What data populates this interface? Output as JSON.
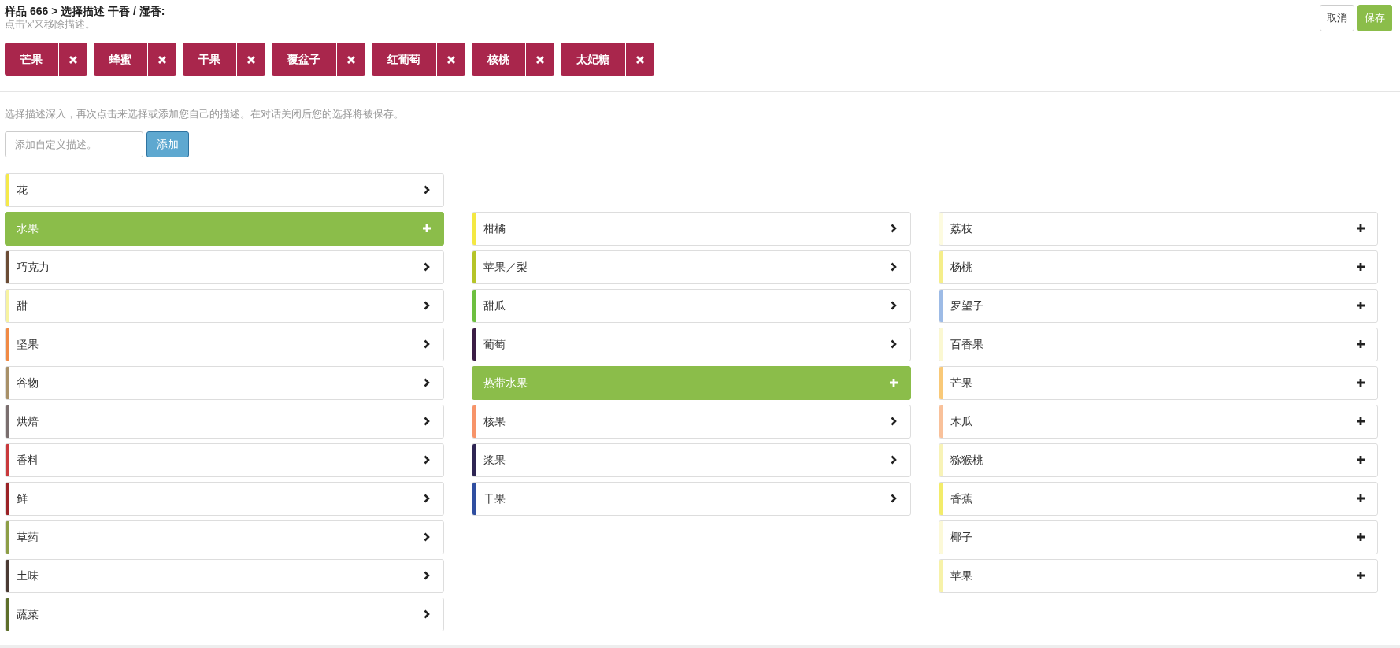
{
  "header": {
    "title": "样品 666 > 选择描述 干香 / 湿香:",
    "hint": "点击'x'来移除描述。"
  },
  "actions": [
    {
      "label": "取消",
      "kind": "secondary"
    },
    {
      "label": "保存",
      "kind": "primary"
    }
  ],
  "selected_tags": [
    {
      "label": "芒果"
    },
    {
      "label": "蜂蜜"
    },
    {
      "label": "干果"
    },
    {
      "label": "覆盆子"
    },
    {
      "label": "红葡萄"
    },
    {
      "label": "核桃"
    },
    {
      "label": "太妃糖"
    }
  ],
  "instructions": "选择描述深入，再次点击来选择或添加您自己的描述。在对话关闭后您的选择将被保存。",
  "custom_input": {
    "placeholder": "添加自定义描述。",
    "button": "添加"
  },
  "columns": [
    {
      "items": [
        {
          "label": "花",
          "color": "#f5e94a",
          "selected": false,
          "expandable": true
        },
        {
          "label": "水果",
          "selected": true
        },
        {
          "label": "巧克力",
          "color": "#6b4c35",
          "selected": false,
          "expandable": true
        },
        {
          "label": "甜",
          "color": "#f7f3a0",
          "selected": false,
          "expandable": true
        },
        {
          "label": "坚果",
          "color": "#f08a45",
          "selected": false,
          "expandable": true
        },
        {
          "label": "谷物",
          "color": "#a89068",
          "selected": false,
          "expandable": true
        },
        {
          "label": "烘焙",
          "color": "#7a6e6e",
          "selected": false,
          "expandable": true
        },
        {
          "label": "香料",
          "color": "#c9393c",
          "selected": false,
          "expandable": true
        },
        {
          "label": "鲜",
          "color": "#9b2226",
          "selected": false,
          "expandable": true
        },
        {
          "label": "草药",
          "color": "#8d9e46",
          "selected": false,
          "expandable": true
        },
        {
          "label": "土味",
          "color": "#4a3a33",
          "selected": false,
          "expandable": true
        },
        {
          "label": "蔬菜",
          "color": "#5d6e2a",
          "selected": false,
          "expandable": true
        }
      ]
    },
    {
      "items": [
        {
          "label": "柑橘",
          "color": "#f4e842",
          "selected": false,
          "expandable": true
        },
        {
          "label": "苹果／梨",
          "color": "#b5c428",
          "selected": false,
          "expandable": true
        },
        {
          "label": "甜瓜",
          "color": "#6dbf3f",
          "selected": false,
          "expandable": true
        },
        {
          "label": "葡萄",
          "color": "#3b1d45",
          "selected": false,
          "expandable": true
        },
        {
          "label": "热带水果",
          "selected": true
        },
        {
          "label": "核果",
          "color": "#f79469",
          "selected": false,
          "expandable": true
        },
        {
          "label": "浆果",
          "color": "#2e2553",
          "selected": false,
          "expandable": true
        },
        {
          "label": "干果",
          "color": "#2f4ea0",
          "selected": false,
          "expandable": true
        }
      ]
    },
    {
      "items": [
        {
          "label": "荔枝",
          "color": "#fdfbe0",
          "selected": false,
          "expandable": false
        },
        {
          "label": "杨桃",
          "color": "#f5ee8a",
          "selected": false,
          "expandable": false
        },
        {
          "label": "罗望子",
          "color": "#9dbbe6",
          "selected": false,
          "expandable": false
        },
        {
          "label": "百香果",
          "color": "#fbf8d2",
          "selected": false,
          "expandable": false
        },
        {
          "label": "芒果",
          "color": "#f9c978",
          "selected": false,
          "expandable": false
        },
        {
          "label": "木瓜",
          "color": "#f9c19a",
          "selected": false,
          "expandable": false
        },
        {
          "label": "猕猴桃",
          "color": "#f8f3b7",
          "selected": false,
          "expandable": false
        },
        {
          "label": "香蕉",
          "color": "#f3ec6a",
          "selected": false,
          "expandable": false
        },
        {
          "label": "椰子",
          "color": "#fcf9d8",
          "selected": false,
          "expandable": false
        },
        {
          "label": "苹果",
          "color": "#f7f2a9",
          "selected": false,
          "expandable": false
        }
      ]
    }
  ]
}
